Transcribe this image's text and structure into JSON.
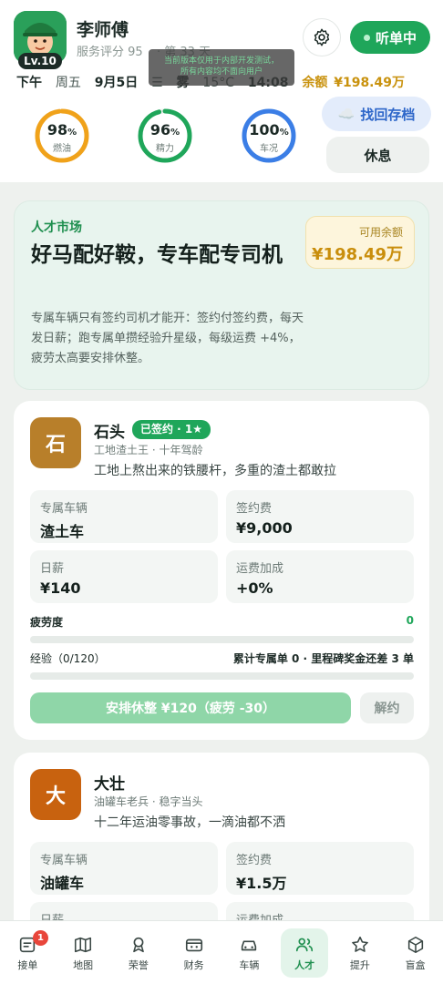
{
  "profile": {
    "name": "李师傅",
    "level": "Lv.10",
    "service_score": "服务评分 95",
    "service_days": "· 第 33 天"
  },
  "header": {
    "status_label": "听单中",
    "notice_line1": "当前版本仅用于内部开发测试，",
    "notice_line2": "所有内容均不面向用户"
  },
  "info_bar": {
    "period": "下午",
    "weekday": "周五",
    "date": "9月5日",
    "weather": "雾",
    "temperature": "15°C",
    "time": "14:08",
    "balance_label": "余额",
    "balance_value": "¥198.49万"
  },
  "gauges": [
    {
      "value": "98",
      "unit": "%",
      "label": "燃油",
      "percent": 98,
      "color": "#f0a21a"
    },
    {
      "value": "96",
      "unit": "%",
      "label": "精力",
      "percent": 96,
      "color": "#1fa65a"
    },
    {
      "value": "100",
      "unit": "%",
      "label": "车况",
      "percent": 100,
      "color": "#3b7ee6"
    }
  ],
  "actions": {
    "recover_label": "找回存档",
    "rest_label": "休息"
  },
  "hero": {
    "tag": "人才市场",
    "title": "好马配好鞍，专车配专司机",
    "description": "专属车辆只有签约司机才能开：签约付签约费，每天发日薪；跑专属单攒经验升星级，每级运费 +4%，疲劳太高要安排休整。",
    "balance_label": "可用余额",
    "balance_value": "¥198.49万"
  },
  "drivers": [
    {
      "initial": "石",
      "name": "石头",
      "badge": "已签约 · 1★",
      "subtitle": "工地渣土王 · 十年驾龄",
      "quote": "工地上熬出来的铁腰杆，多重的渣土都敢拉",
      "avatar_color": "#b87f2a",
      "vehicle_label": "专属车辆",
      "vehicle_value": "渣土车",
      "fee_label": "签约费",
      "fee_value": "¥9,000",
      "wage_label": "日薪",
      "wage_value": "¥140",
      "bonus_label": "运费加成",
      "bonus_value": "+0%",
      "fatigue_label": "疲劳度",
      "fatigue_value": "0",
      "fatigue_percent": 0,
      "exp_label": "经验（0/120）",
      "exp_note": "累计专属单 0 · 里程碑奖金还差 3 单",
      "exp_percent": 0,
      "rest_action": "安排休整 ¥120（疲劳 -30）",
      "terminate": "解约"
    },
    {
      "initial": "大",
      "name": "大壮",
      "subtitle": "油罐车老兵 · 稳字当头",
      "quote": "十二年运油零事故，一滴油都不洒",
      "avatar_color": "#c8620f",
      "vehicle_label": "专属车辆",
      "vehicle_value": "油罐车",
      "fee_label": "签约费",
      "fee_value": "¥1.5万",
      "wage_label": "日薪",
      "bonus_label": "运费加成"
    }
  ],
  "nav": [
    {
      "label": "接单",
      "icon": "orders-icon",
      "badge": "1"
    },
    {
      "label": "地图",
      "icon": "map-icon"
    },
    {
      "label": "荣誉",
      "icon": "medal-icon"
    },
    {
      "label": "财务",
      "icon": "wallet-icon"
    },
    {
      "label": "车辆",
      "icon": "car-icon"
    },
    {
      "label": "人才",
      "icon": "people-icon",
      "active": true
    },
    {
      "label": "提升",
      "icon": "star-icon"
    },
    {
      "label": "盲盒",
      "icon": "box-icon"
    }
  ]
}
